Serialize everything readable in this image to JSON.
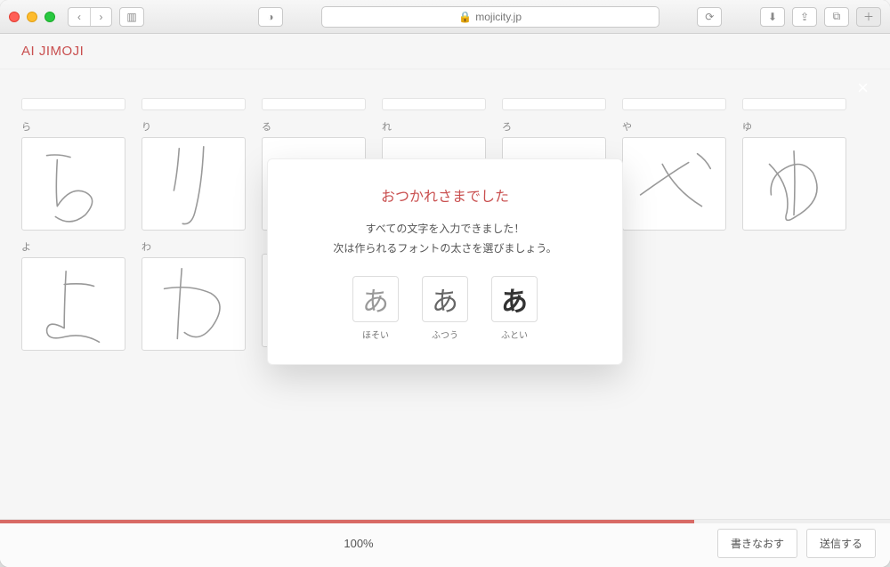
{
  "browser": {
    "url": "mojicity.jp",
    "lock_icon": "🔒"
  },
  "app": {
    "title": "AI JIMOJI",
    "close_label": "×",
    "progress": {
      "percent_text": "100%",
      "fill_css_width": "78%"
    },
    "actions": {
      "rewrite": "書きなおす",
      "submit": "送信する"
    }
  },
  "rows": [
    {
      "cells": [
        "ら",
        "り",
        "る",
        "れ",
        "ろ",
        "や",
        "ゆ"
      ]
    },
    {
      "cells": [
        "よ",
        "わ",
        "",
        "",
        "",
        "",
        ""
      ]
    }
  ],
  "modal": {
    "title": "おつかれさまでした",
    "line1": "すべての文字を入力できました！",
    "line2": "次は作られるフォントの太さを選びましょう。",
    "sample_char": "あ",
    "weights": [
      {
        "key": "thin",
        "label": "ほそい"
      },
      {
        "key": "normal",
        "label": "ふつう"
      },
      {
        "key": "bold",
        "label": "ふとい"
      }
    ]
  }
}
